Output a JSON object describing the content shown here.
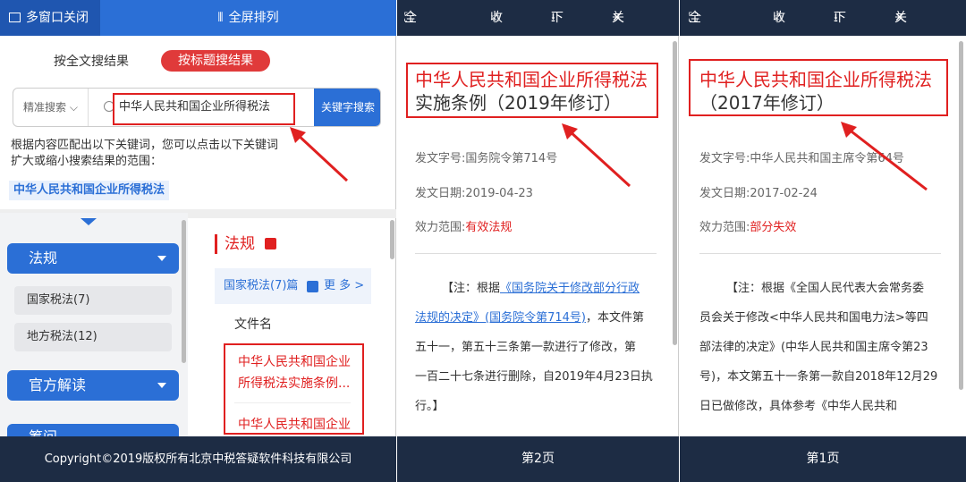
{
  "left": {
    "topbar": {
      "close_all": "多窗口关闭",
      "fullscreen": "全屏排列"
    },
    "tabs": {
      "fulltext": "按全文搜结果",
      "title": "按标题搜结果"
    },
    "search": {
      "precise": "精准搜索",
      "query": "中华人民共和国企业所得税法",
      "button": "关键字搜索"
    },
    "hint": "根据内容匹配出以下关键词，您可以点击以下关键词扩大或缩小搜索结果的范围：",
    "keyword": "中华人民共和国企业所得税法",
    "nav": {
      "fagui": "法规",
      "items": [
        "国家税法(7)",
        "地方税法(12)"
      ],
      "guanfang": "官方解读",
      "next": "筹问"
    },
    "results": {
      "section": "法规",
      "header": "国家税法(7)篇",
      "more": "更 多 >",
      "col_name": "文件名",
      "item1_line1": "中华人民共和国企业",
      "item1_line2": "所得税法实施条例...",
      "item2_line1": "中华人民共和国企业"
    },
    "footer": "Copyright©2019版权所有北京中税答疑软件科技有限公司"
  },
  "doc2": {
    "toolbar": {
      "fullscreen": "全屏显示",
      "fav": "收藏",
      "download": "下载",
      "close": "关闭"
    },
    "title": "中华人民共和国企业所得税法",
    "subtitle": "实施条例（2019年修订）",
    "doc_no": "发文字号:国务院令第714号",
    "date": "发文日期:2019-04-23",
    "scope_label": "效力范围:",
    "scope_value": "有效法规",
    "note_line1a": "【注：根据",
    "note_link1": "《国务院关于修改部分行政",
    "note_link2": "法规的决定》(国务院令第714号)",
    "note_line2b": "，本文件第",
    "note_line3": "五十一，第五十三条第一款进行了修改，第",
    "note_line4": "一百二十七条进行删除，自2019年4月23日执",
    "note_line5": "行。】",
    "page": "第2页"
  },
  "doc1": {
    "toolbar": {
      "fullscreen": "全屏显示",
      "fav": "收藏",
      "download": "下载",
      "close": "关闭"
    },
    "title": "中华人民共和国企业所得税法",
    "subtitle": "（2017年修订）",
    "doc_no": "发文字号:中华人民共和国主席令第64号",
    "date": "发文日期:2017-02-24",
    "scope_label": "效力范围:",
    "scope_value": "部分失效",
    "note_line1": "【注：根据《全国人民代表大会常务委",
    "note_line2": "员会关于修改<中华人民共和国电力法>等四",
    "note_line3": "部法律的决定》(中华人民共和国主席令第23",
    "note_line4": "号)，本文第五十一条第一款自2018年12月29",
    "note_line5": "日已做修改，具体参考《中华人民共和",
    "page": "第1页"
  },
  "colors": {
    "blue": "#2b6fd6",
    "red": "#e02020",
    "navy": "#1d2c44"
  }
}
